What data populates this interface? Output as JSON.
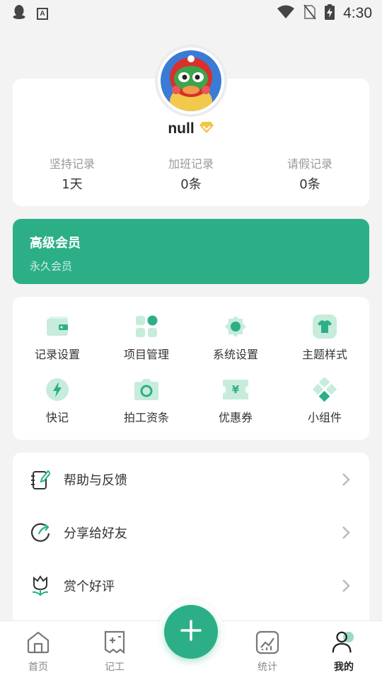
{
  "status_bar": {
    "time": "4:30",
    "icons": [
      "qq-icon",
      "font-icon",
      "wifi-icon",
      "no-sim-icon",
      "battery-charging-icon"
    ]
  },
  "profile": {
    "username": "null",
    "badge_icon": "vip-diamond-icon",
    "stats": [
      {
        "label": "坚持记录",
        "value": "1天"
      },
      {
        "label": "加班记录",
        "value": "0条"
      },
      {
        "label": "请假记录",
        "value": "0条"
      }
    ]
  },
  "vip": {
    "title": "高级会员",
    "subtitle": "永久会员"
  },
  "grid": [
    {
      "label": "记录设置",
      "icon": "wallet-icon"
    },
    {
      "label": "项目管理",
      "icon": "apps-icon"
    },
    {
      "label": "系统设置",
      "icon": "settings-icon"
    },
    {
      "label": "主题样式",
      "icon": "tshirt-icon"
    },
    {
      "label": "快记",
      "icon": "lightning-icon"
    },
    {
      "label": "拍工资条",
      "icon": "camera-icon"
    },
    {
      "label": "优惠券",
      "icon": "coupon-icon"
    },
    {
      "label": "小组件",
      "icon": "widget-icon"
    }
  ],
  "list": [
    {
      "label": "帮助与反馈",
      "icon": "help-notebook-icon"
    },
    {
      "label": "分享给好友",
      "icon": "share-icon"
    },
    {
      "label": "赏个好评",
      "icon": "flower-icon"
    }
  ],
  "nav": [
    {
      "label": "首页",
      "icon": "home-icon",
      "active": false
    },
    {
      "label": "记工",
      "icon": "record-icon",
      "active": false
    },
    {
      "label": "统计",
      "icon": "chart-icon",
      "active": false
    },
    {
      "label": "我的",
      "icon": "user-icon",
      "active": true
    }
  ],
  "colors": {
    "accent": "#2caf87",
    "background": "#f3f3f3",
    "icon_light": "#c7ecdc",
    "icon_dark": "#2caf87",
    "badge": "#f4c542"
  }
}
